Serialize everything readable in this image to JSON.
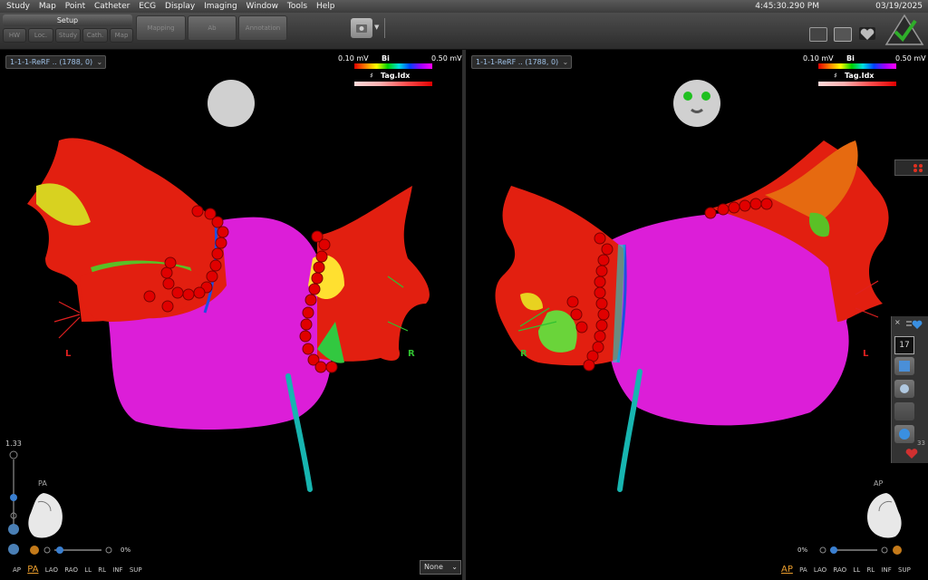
{
  "menu": [
    "Study",
    "Map",
    "Point",
    "Catheter",
    "ECG",
    "Display",
    "Imaging",
    "Window",
    "Tools",
    "Help"
  ],
  "status": {
    "time": "4:45:30.290 PM",
    "date": "03/19/2025"
  },
  "toolbar": {
    "setup_label": "Setup",
    "subtabs": [
      "HW",
      "Loc.",
      "Study",
      "Cath.",
      "Map"
    ],
    "big_buttons": [
      "Mapping",
      "Ab",
      "Annotation"
    ]
  },
  "left_view": {
    "map_name": "1-1-1-ReRF .. (1788, 0)",
    "legend_min": "0.10 mV",
    "legend_title": "Bi",
    "legend_max": "0.50 mV",
    "tag_label": "Tag.Idx",
    "orient_L": "L",
    "orient_R": "R",
    "zoom": "1.33",
    "view_label": "PA",
    "pct": "0%",
    "views": [
      "AP",
      "PA",
      "LAO",
      "RAO",
      "LL",
      "RL",
      "INF",
      "SUP"
    ],
    "active_view": "PA",
    "none_dropdown": "None"
  },
  "right_view": {
    "map_name": "1-1-1-ReRF .. (1788, 0)",
    "legend_min": "0.10 mV",
    "legend_title": "Bi",
    "legend_max": "0.50 mV",
    "tag_label": "Tag.Idx",
    "orient_L": "L",
    "orient_R": "R",
    "view_label": "AP",
    "pct": "0%",
    "views": [
      "AP",
      "PA",
      "LAO",
      "RAO",
      "LL",
      "RL",
      "INF",
      "SUP"
    ],
    "active_view": "AP"
  },
  "side_panel": {
    "count": "17",
    "value": "33"
  },
  "colors": {
    "accent": "#e99c2c",
    "tissue": "#e020e0",
    "scar": "#e21f10",
    "tag": "#e00000",
    "catheter": "#17b5b0"
  }
}
